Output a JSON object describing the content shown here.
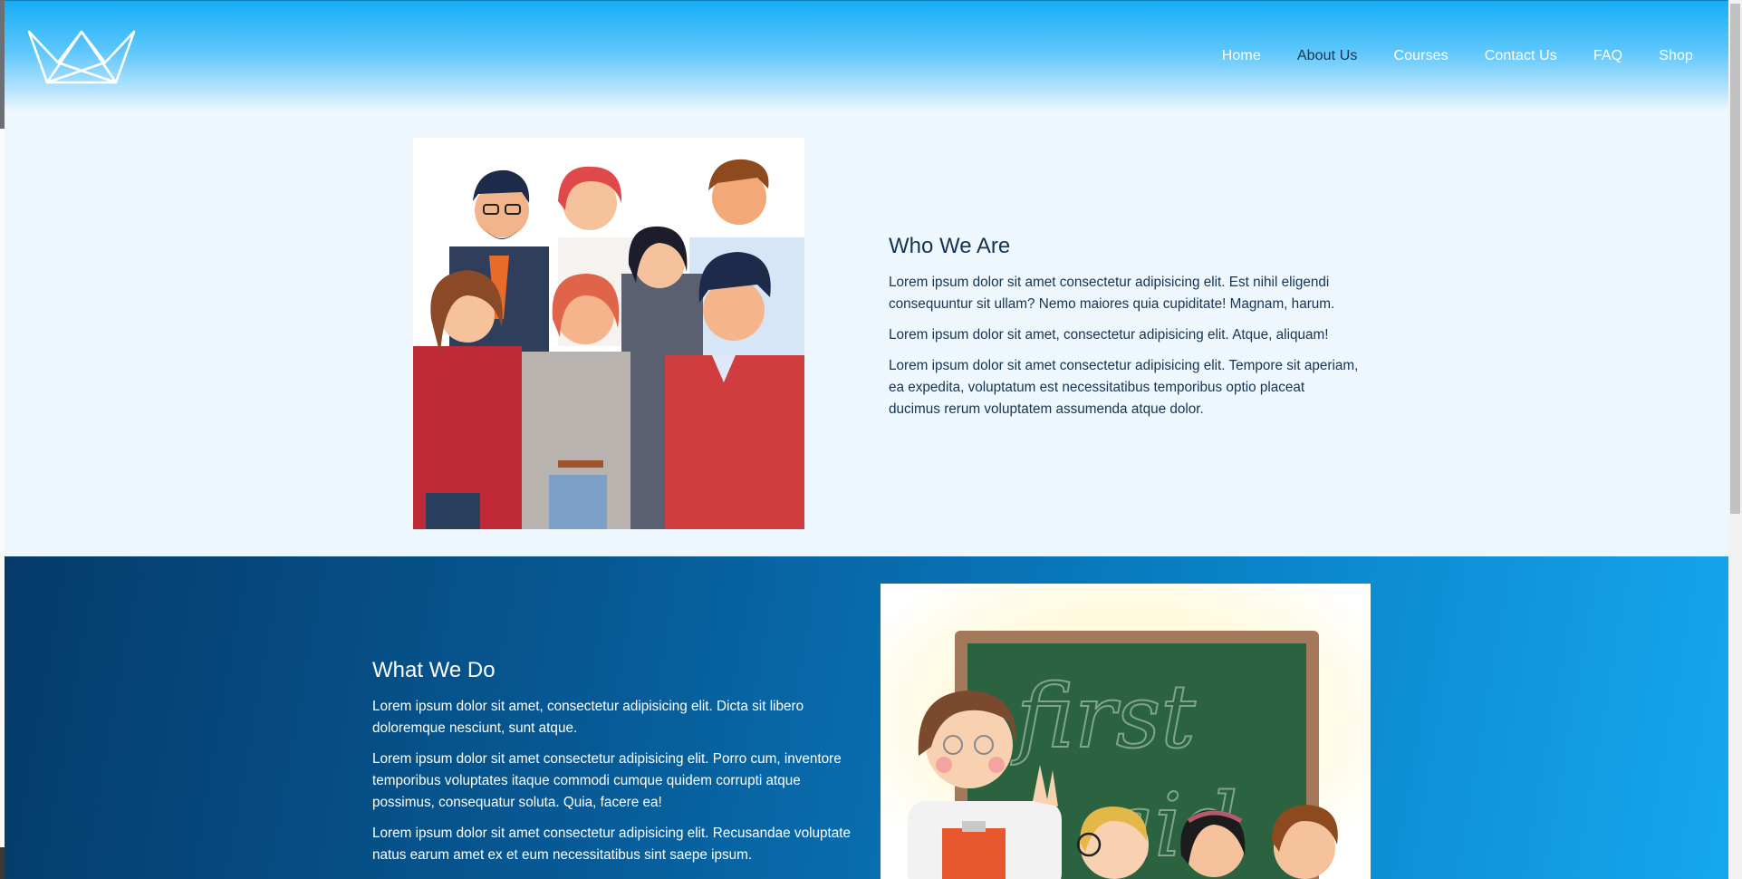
{
  "nav": {
    "items": [
      {
        "label": "Home",
        "name": "nav-home"
      },
      {
        "label": "About Us",
        "name": "nav-about-us"
      },
      {
        "label": "Courses",
        "name": "nav-courses"
      },
      {
        "label": "Contact Us",
        "name": "nav-contact-us"
      },
      {
        "label": "FAQ",
        "name": "nav-faq"
      },
      {
        "label": "Shop",
        "name": "nav-shop"
      }
    ],
    "active": "About Us"
  },
  "logo_icon": "crown-icon",
  "who": {
    "title": "Who We Are",
    "paragraphs": [
      "Lorem ipsum dolor sit amet consectetur adipisicing elit. Est nihil eligendi consequuntur sit ullam? Nemo maiores quia cupiditate! Magnam, harum.",
      "Lorem ipsum dolor sit amet, consectetur adipisicing elit. Atque, aliquam!",
      "Lorem ipsum dolor sit amet consectetur adipisicing elit. Tempore sit aperiam, ea expedita, voluptatum est necessitatibus temporibus optio placeat ducimus rerum voluptatem assumenda atque dolor."
    ],
    "image": "team-illustration"
  },
  "what": {
    "title": "What We Do",
    "paragraphs": [
      "Lorem ipsum dolor sit amet, consectetur adipisicing elit. Dicta sit libero doloremque nesciunt, sunt atque.",
      "Lorem ipsum dolor sit amet consectetur adipisicing elit. Porro cum, inventore temporibus voluptates itaque commodi cumque quidem corrupti atque possimus, consequatur soluta. Quia, facere ea!",
      "Lorem ipsum dolor sit amet consectetur adipisicing elit. Recusandae voluptate natus earum amet ex et eum necessitatibus sint saepe ipsum."
    ],
    "image": "classroom-illustration",
    "chalkboard_text": [
      "first",
      "aid"
    ]
  },
  "colors": {
    "header": "#16aef8",
    "text_dark": "#153452",
    "section_light": "#eef7fe",
    "section_dark": "#075a96"
  }
}
